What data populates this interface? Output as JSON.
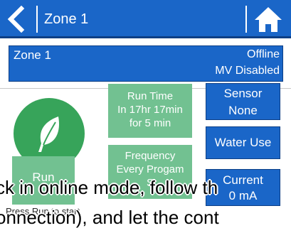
{
  "header": {
    "title": "Zone 1",
    "back_icon": "chevron-left-icon",
    "home_icon": "home-icon"
  },
  "status": {
    "name": "Zone 1",
    "connection": "Offline",
    "master_valve": "MV Disabled"
  },
  "runtime": {
    "line1": "Run Time",
    "line2": "In 17hr 17min",
    "line3": "for 5 min"
  },
  "frequency": {
    "line1": "Frequency",
    "line2": "Every Progam",
    "line3": "S"
  },
  "run_button": {
    "label": "Run"
  },
  "hint": "Press Run to start",
  "sensor": {
    "line1": "Sensor",
    "line2": "None"
  },
  "water_use": {
    "label": "Water Use"
  },
  "current": {
    "line1": "Current",
    "line2": "0 mA"
  },
  "overlay": {
    "line1": "ck in online mode, follow th",
    "line2": "onnection), and let the cont"
  },
  "colors": {
    "primary_blue": "#1a66c8",
    "dark_blue": "#0d3f86",
    "leaf_green": "#37a45a",
    "tile_green": "#72c191"
  }
}
